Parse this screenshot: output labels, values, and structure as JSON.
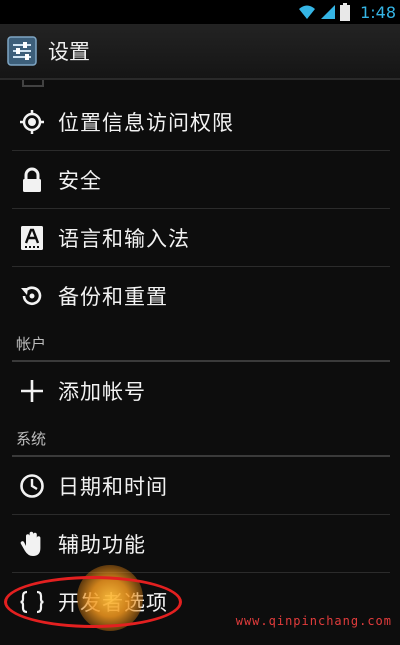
{
  "status_bar": {
    "time": "1:48"
  },
  "action_bar": {
    "title": "设置",
    "icon": "settings-sliders-icon"
  },
  "items_top": [
    {
      "label": "位置信息访问权限",
      "icon": "location-icon"
    },
    {
      "label": "安全",
      "icon": "lock-icon"
    },
    {
      "label": "语言和输入法",
      "icon": "keyboard-a-icon"
    },
    {
      "label": "备份和重置",
      "icon": "backup-restore-icon"
    }
  ],
  "section_accounts": {
    "header": "帐户",
    "items": [
      {
        "label": "添加帐号",
        "icon": "plus-icon"
      }
    ]
  },
  "section_system": {
    "header": "系统",
    "items": [
      {
        "label": "日期和时间",
        "icon": "clock-icon"
      },
      {
        "label": "辅助功能",
        "icon": "hand-icon"
      },
      {
        "label": "开发者选项",
        "icon": "braces-icon"
      }
    ]
  },
  "watermark": "www.qinpinchang.com",
  "colors": {
    "accent": "#35b5e5",
    "annotation": "#e32020"
  }
}
